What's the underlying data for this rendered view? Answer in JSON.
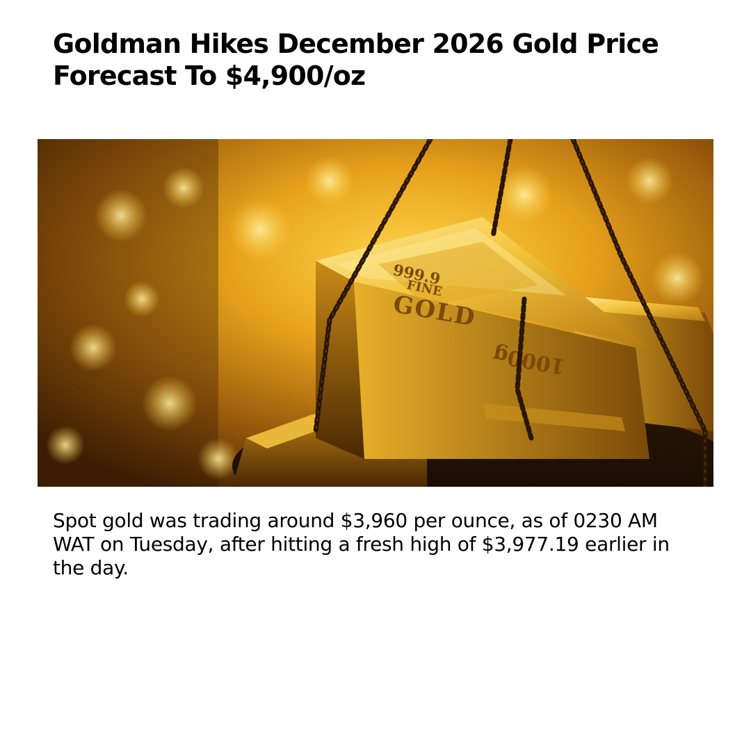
{
  "article": {
    "headline": "Goldman Hikes December 2026 Gold Price Forecast To $4,900/oz",
    "body": "Spot gold was trading around $3,960 per ounce, as of 0230 AM WAT on Tuesday, after hitting a fresh high of $3,977.19 earlier in the day.",
    "image": {
      "subject": "gold-bars-on-scale",
      "bar_stamp": {
        "purity": "999.9",
        "grade": "FINE",
        "metal": "GOLD",
        "weight": "1000g"
      }
    }
  },
  "colors": {
    "background": "#ffffff",
    "text": "#000000",
    "gold_highlight": "#ffe27a",
    "gold_mid": "#d9a21a",
    "gold_shadow": "#5a3206",
    "chain": "#2a1604"
  }
}
